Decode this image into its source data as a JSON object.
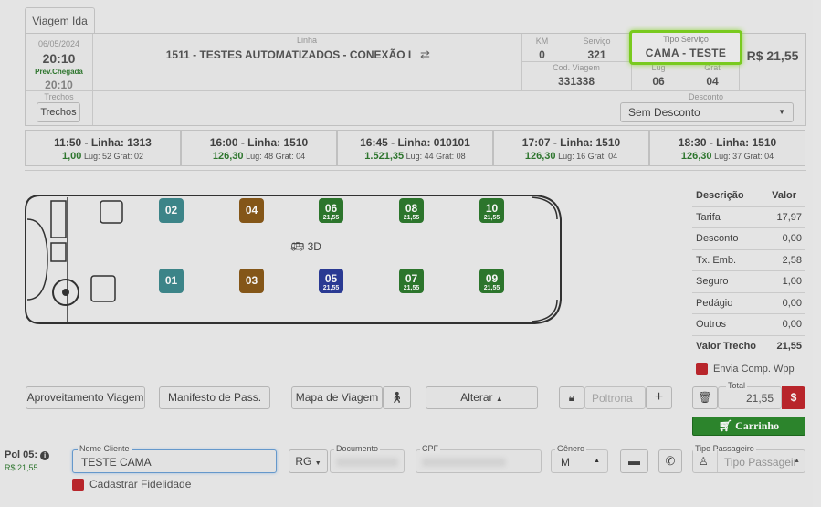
{
  "tab": {
    "label": "Viagem Ida"
  },
  "trip_header": {
    "date": "06/05/2024",
    "time": "20:10",
    "arrival_label": "Prev.Chegada",
    "arrival_time": "20:10",
    "linha_label": "Linha",
    "linha_value": "1511 - TESTES AUTOMATIZADOS - CONEXÃO I",
    "km_label": "KM",
    "km_value": "0",
    "servico_label": "Serviço",
    "servico_value": "321",
    "tipo_servico_label": "Tipo Serviço",
    "tipo_servico_value": "CAMA - TESTE",
    "price": "R$ 21,55",
    "cod_viagem_label": "Cod. Viagem",
    "cod_viagem_value": "331338",
    "lug_label": "Lug",
    "lug_value": "06",
    "grat_label": "Grat",
    "grat_value": "04",
    "trechos_label": "Trechos",
    "trechos_button": "Trechos",
    "desconto_label": "Desconto",
    "desconto_value": "Sem Desconto"
  },
  "trips": [
    {
      "title": "11:50 - Linha: 1313",
      "price": "1,00",
      "info": "Lug: 52 Grat: 02"
    },
    {
      "title": "16:00 - Linha: 1510",
      "price": "126,30",
      "info": "Lug: 48 Grat: 04"
    },
    {
      "title": "16:45 - Linha: 010101",
      "price": "1.521,35",
      "info": "Lug: 44 Grat: 08"
    },
    {
      "title": "17:07 - Linha: 1510",
      "price": "126,30",
      "info": "Lug: 16 Grat: 04"
    },
    {
      "title": "18:30 - Linha: 1510",
      "price": "126,30",
      "info": "Lug: 37 Grat: 04"
    }
  ],
  "seats": [
    {
      "num": "02",
      "price": "",
      "color": "#3f8a8e"
    },
    {
      "num": "04",
      "price": "",
      "color": "#8a5a1a"
    },
    {
      "num": "06",
      "price": "21,55",
      "color": "#2e7a2e"
    },
    {
      "num": "08",
      "price": "21,55",
      "color": "#2e7a2e"
    },
    {
      "num": "10",
      "price": "21,55",
      "color": "#2e7a2e"
    },
    {
      "num": "01",
      "price": "",
      "color": "#3f8a8e"
    },
    {
      "num": "03",
      "price": "",
      "color": "#8a5a1a"
    },
    {
      "num": "05",
      "price": "21,55",
      "color": "#2c3d9a"
    },
    {
      "num": "07",
      "price": "21,55",
      "color": "#2e7a2e"
    },
    {
      "num": "09",
      "price": "21,55",
      "color": "#2e7a2e"
    }
  ],
  "bus": {
    "label_3d": "3D"
  },
  "price_table": {
    "col_desc": "Descrição",
    "col_val": "Valor",
    "rows": [
      {
        "label": "Tarifa",
        "value": "17,97"
      },
      {
        "label": "Desconto",
        "value": "0,00"
      },
      {
        "label": "Tx. Emb.",
        "value": "2,58"
      },
      {
        "label": "Seguro",
        "value": "1,00"
      },
      {
        "label": "Pedágio",
        "value": "0,00"
      },
      {
        "label": "Outros",
        "value": "0,00"
      }
    ],
    "total_label": "Valor Trecho",
    "total_value": "21,55"
  },
  "envia_wpp": "Envia Comp. Wpp",
  "actions": {
    "aproveitamento": "Aproveitamento Viagem",
    "manifesto": "Manifesto de Pass.",
    "mapa": "Mapa de Viagem",
    "alterar": "Alterar",
    "poltrona_placeholder": "Poltrona",
    "total_label": "Total",
    "total_value": "21,55",
    "currency_symbol": "$",
    "carrinho": "Carrinho"
  },
  "passenger": {
    "pol_label": "Pol 05:",
    "pol_price": "R$ 21,55",
    "nome_label": "Nome Cliente",
    "nome_value": "TESTE CAMA",
    "doc_type": "RG",
    "documento_label": "Documento",
    "cpf_label": "CPF",
    "genero_label": "Gênero",
    "genero_value": "M",
    "tipo_label": "Tipo Passageiro",
    "tipo_placeholder": "Tipo Passageir",
    "fidelidade": "Cadastrar Fidelidade"
  },
  "colors": {
    "highlight": "#7ed321",
    "accent_red": "#c0272d",
    "cart_green": "#2e8a2e"
  }
}
